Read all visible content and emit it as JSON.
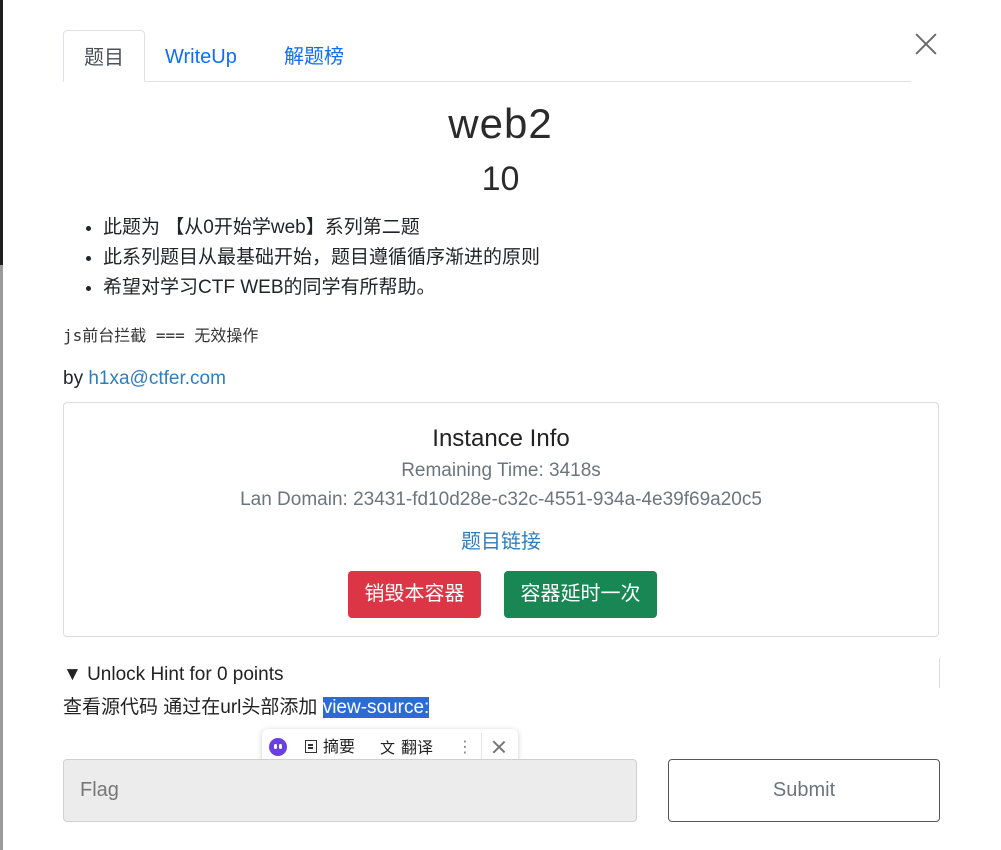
{
  "tabs": {
    "challenge": "题目",
    "writeup": "WriteUp",
    "solves": "解题榜"
  },
  "challenge": {
    "name": "web2",
    "points": "10",
    "description": [
      "此题为 【从0开始学web】系列第二题",
      "此系列题目从最基础开始，题目遵循循序渐进的原则",
      "希望对学习CTF WEB的同学有所帮助。"
    ],
    "code_note": "js前台拦截 === 无效操作",
    "by_prefix": "by ",
    "author_email": "h1xa@ctfer.com"
  },
  "instance": {
    "title": "Instance Info",
    "remaining": "Remaining Time: 3418s",
    "domain": "Lan Domain: 23431-fd10d28e-c32c-4551-934a-4e39f69a20c5",
    "link": "题目链接",
    "destroy_button": "销毁本容器",
    "extend_button": "容器延时一次"
  },
  "hint": {
    "summary": "▼ Unlock Hint for 0 points",
    "text_prefix": "查看源代码 通过在url头部添加 ",
    "text_highlight": "view-source:"
  },
  "popup": {
    "summary": "摘要",
    "translate": "翻译",
    "more": "⋮"
  },
  "flag": {
    "placeholder": "Flag",
    "submit": "Submit"
  }
}
